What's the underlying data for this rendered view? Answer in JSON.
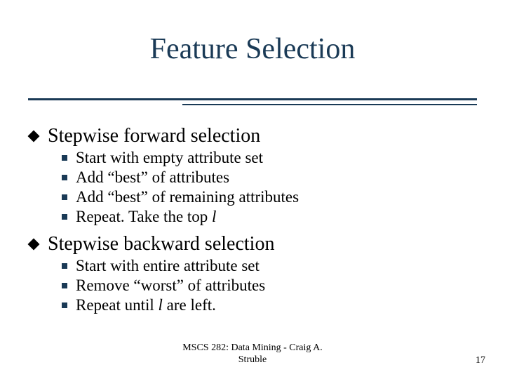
{
  "title": "Feature Selection",
  "bullets": [
    {
      "text": "Stepwise forward selection",
      "sub": [
        {
          "text": "Start with empty attribute set"
        },
        {
          "text": "Add “best” of attributes"
        },
        {
          "text": "Add “best” of remaining attributes"
        },
        {
          "text_prefix": "Repeat. Take the top ",
          "italic": "l",
          "text_suffix": ""
        }
      ]
    },
    {
      "text": "Stepwise backward selection",
      "sub": [
        {
          "text": "Start with entire attribute set"
        },
        {
          "text": "Remove “worst” of attributes"
        },
        {
          "text_prefix": "Repeat until ",
          "italic": "l",
          "text_suffix": " are left."
        }
      ]
    }
  ],
  "footer": {
    "line1": "MSCS 282: Data Mining - Craig A.",
    "line2": "Struble"
  },
  "page_number": "17"
}
